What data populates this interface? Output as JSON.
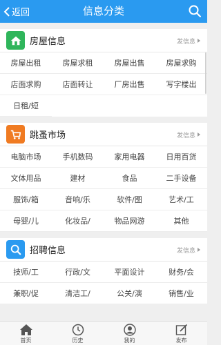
{
  "header": {
    "back_label": "返回",
    "title": "信息分类"
  },
  "sections": [
    {
      "title": "房屋信息",
      "post_label": "发信息",
      "icon": "house-icon",
      "color": "#2fb55b",
      "items": [
        "房屋出租",
        "房屋求租",
        "房屋出售",
        "房屋求购",
        "店面求购",
        "店面转让",
        "厂房出售",
        "写字楼出",
        "日租/短"
      ]
    },
    {
      "title": "跳蚤市场",
      "post_label": "发信息",
      "icon": "cart-icon",
      "color": "#f07b22",
      "items": [
        "电脑市场",
        "手机数码",
        "家用电器",
        "日用百货",
        "文体用品",
        "建材",
        "食品",
        "二手设备",
        "服饰/箱",
        "音响/乐",
        "软件/图",
        "艺术/工",
        "母婴/儿",
        "化妆品/",
        "物品网游",
        "其他"
      ]
    },
    {
      "title": "招聘信息",
      "post_label": "发信息",
      "icon": "magnifier-icon",
      "color": "#2a9af0",
      "items": [
        "技师/工",
        "行政/文",
        "平面设计",
        "财务/会",
        "兼职/促",
        "清洁工/",
        "公关/演",
        "销售/业"
      ]
    }
  ],
  "tabbar": {
    "items": [
      {
        "label": "首页",
        "icon": "home-icon"
      },
      {
        "label": "历史",
        "icon": "clock-icon"
      },
      {
        "label": "我的",
        "icon": "user-icon"
      },
      {
        "label": "发布",
        "icon": "edit-icon"
      }
    ]
  }
}
